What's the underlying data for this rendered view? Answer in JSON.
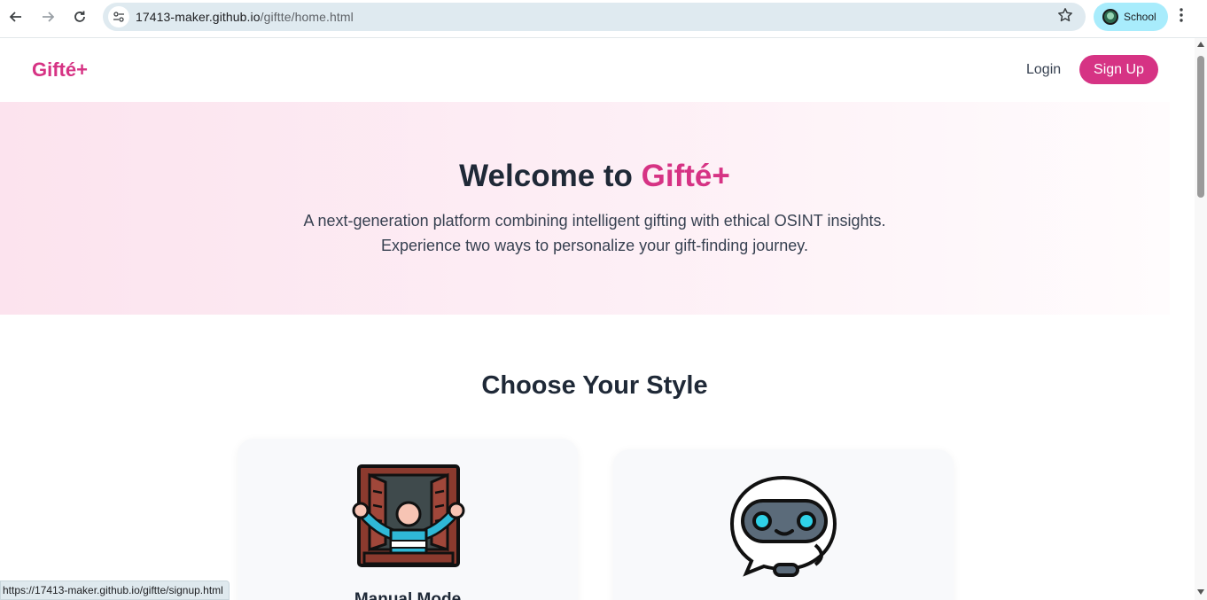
{
  "browser": {
    "url_host": "17413-maker.github.io",
    "url_path": "/giftte/home.html",
    "profile_label": "School",
    "back_icon": "arrow-left-icon",
    "forward_icon": "arrow-right-icon",
    "reload_icon": "reload-icon",
    "bookmark_icon": "star-icon",
    "menu_icon": "kebab-menu-icon"
  },
  "header": {
    "brand": "Gifté+",
    "login_label": "Login",
    "signup_label": "Sign Up"
  },
  "hero": {
    "title_prefix": "Welcome to ",
    "title_brand": "Gifté+",
    "line1": "A next-generation platform combining intelligent gifting with ethical OSINT insights.",
    "line2": "Experience two ways to personalize your gift-finding journey."
  },
  "styles_section": {
    "title": "Choose Your Style",
    "cards": [
      {
        "title": "Manual Mode",
        "icon": "open-window-person-icon"
      },
      {
        "title": "",
        "icon": "robot-chat-icon"
      }
    ]
  },
  "status_bar": {
    "link_url": "https://17413-maker.github.io/giftte/signup.html"
  },
  "colors": {
    "brand": "#d63384",
    "heading": "#1f2937",
    "body_text": "#374151",
    "omnibox": "#dfeaf0",
    "profile_chip": "#a8ecfc"
  }
}
